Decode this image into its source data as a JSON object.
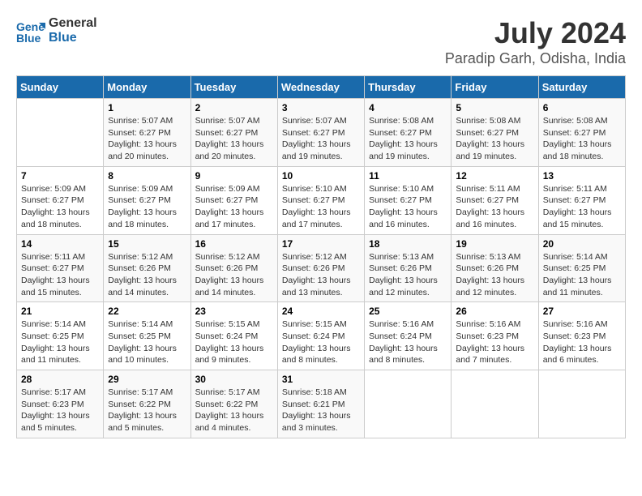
{
  "logo": {
    "line1": "General",
    "line2": "Blue"
  },
  "title": "July 2024",
  "subtitle": "Paradip Garh, Odisha, India",
  "days_of_week": [
    "Sunday",
    "Monday",
    "Tuesday",
    "Wednesday",
    "Thursday",
    "Friday",
    "Saturday"
  ],
  "weeks": [
    [
      {
        "day": "",
        "info": ""
      },
      {
        "day": "1",
        "info": "Sunrise: 5:07 AM\nSunset: 6:27 PM\nDaylight: 13 hours\nand 20 minutes."
      },
      {
        "day": "2",
        "info": "Sunrise: 5:07 AM\nSunset: 6:27 PM\nDaylight: 13 hours\nand 20 minutes."
      },
      {
        "day": "3",
        "info": "Sunrise: 5:07 AM\nSunset: 6:27 PM\nDaylight: 13 hours\nand 19 minutes."
      },
      {
        "day": "4",
        "info": "Sunrise: 5:08 AM\nSunset: 6:27 PM\nDaylight: 13 hours\nand 19 minutes."
      },
      {
        "day": "5",
        "info": "Sunrise: 5:08 AM\nSunset: 6:27 PM\nDaylight: 13 hours\nand 19 minutes."
      },
      {
        "day": "6",
        "info": "Sunrise: 5:08 AM\nSunset: 6:27 PM\nDaylight: 13 hours\nand 18 minutes."
      }
    ],
    [
      {
        "day": "7",
        "info": "Sunrise: 5:09 AM\nSunset: 6:27 PM\nDaylight: 13 hours\nand 18 minutes."
      },
      {
        "day": "8",
        "info": "Sunrise: 5:09 AM\nSunset: 6:27 PM\nDaylight: 13 hours\nand 18 minutes."
      },
      {
        "day": "9",
        "info": "Sunrise: 5:09 AM\nSunset: 6:27 PM\nDaylight: 13 hours\nand 17 minutes."
      },
      {
        "day": "10",
        "info": "Sunrise: 5:10 AM\nSunset: 6:27 PM\nDaylight: 13 hours\nand 17 minutes."
      },
      {
        "day": "11",
        "info": "Sunrise: 5:10 AM\nSunset: 6:27 PM\nDaylight: 13 hours\nand 16 minutes."
      },
      {
        "day": "12",
        "info": "Sunrise: 5:11 AM\nSunset: 6:27 PM\nDaylight: 13 hours\nand 16 minutes."
      },
      {
        "day": "13",
        "info": "Sunrise: 5:11 AM\nSunset: 6:27 PM\nDaylight: 13 hours\nand 15 minutes."
      }
    ],
    [
      {
        "day": "14",
        "info": "Sunrise: 5:11 AM\nSunset: 6:27 PM\nDaylight: 13 hours\nand 15 minutes."
      },
      {
        "day": "15",
        "info": "Sunrise: 5:12 AM\nSunset: 6:26 PM\nDaylight: 13 hours\nand 14 minutes."
      },
      {
        "day": "16",
        "info": "Sunrise: 5:12 AM\nSunset: 6:26 PM\nDaylight: 13 hours\nand 14 minutes."
      },
      {
        "day": "17",
        "info": "Sunrise: 5:12 AM\nSunset: 6:26 PM\nDaylight: 13 hours\nand 13 minutes."
      },
      {
        "day": "18",
        "info": "Sunrise: 5:13 AM\nSunset: 6:26 PM\nDaylight: 13 hours\nand 12 minutes."
      },
      {
        "day": "19",
        "info": "Sunrise: 5:13 AM\nSunset: 6:26 PM\nDaylight: 13 hours\nand 12 minutes."
      },
      {
        "day": "20",
        "info": "Sunrise: 5:14 AM\nSunset: 6:25 PM\nDaylight: 13 hours\nand 11 minutes."
      }
    ],
    [
      {
        "day": "21",
        "info": "Sunrise: 5:14 AM\nSunset: 6:25 PM\nDaylight: 13 hours\nand 11 minutes."
      },
      {
        "day": "22",
        "info": "Sunrise: 5:14 AM\nSunset: 6:25 PM\nDaylight: 13 hours\nand 10 minutes."
      },
      {
        "day": "23",
        "info": "Sunrise: 5:15 AM\nSunset: 6:24 PM\nDaylight: 13 hours\nand 9 minutes."
      },
      {
        "day": "24",
        "info": "Sunrise: 5:15 AM\nSunset: 6:24 PM\nDaylight: 13 hours\nand 8 minutes."
      },
      {
        "day": "25",
        "info": "Sunrise: 5:16 AM\nSunset: 6:24 PM\nDaylight: 13 hours\nand 8 minutes."
      },
      {
        "day": "26",
        "info": "Sunrise: 5:16 AM\nSunset: 6:23 PM\nDaylight: 13 hours\nand 7 minutes."
      },
      {
        "day": "27",
        "info": "Sunrise: 5:16 AM\nSunset: 6:23 PM\nDaylight: 13 hours\nand 6 minutes."
      }
    ],
    [
      {
        "day": "28",
        "info": "Sunrise: 5:17 AM\nSunset: 6:23 PM\nDaylight: 13 hours\nand 5 minutes."
      },
      {
        "day": "29",
        "info": "Sunrise: 5:17 AM\nSunset: 6:22 PM\nDaylight: 13 hours\nand 5 minutes."
      },
      {
        "day": "30",
        "info": "Sunrise: 5:17 AM\nSunset: 6:22 PM\nDaylight: 13 hours\nand 4 minutes."
      },
      {
        "day": "31",
        "info": "Sunrise: 5:18 AM\nSunset: 6:21 PM\nDaylight: 13 hours\nand 3 minutes."
      },
      {
        "day": "",
        "info": ""
      },
      {
        "day": "",
        "info": ""
      },
      {
        "day": "",
        "info": ""
      }
    ]
  ]
}
